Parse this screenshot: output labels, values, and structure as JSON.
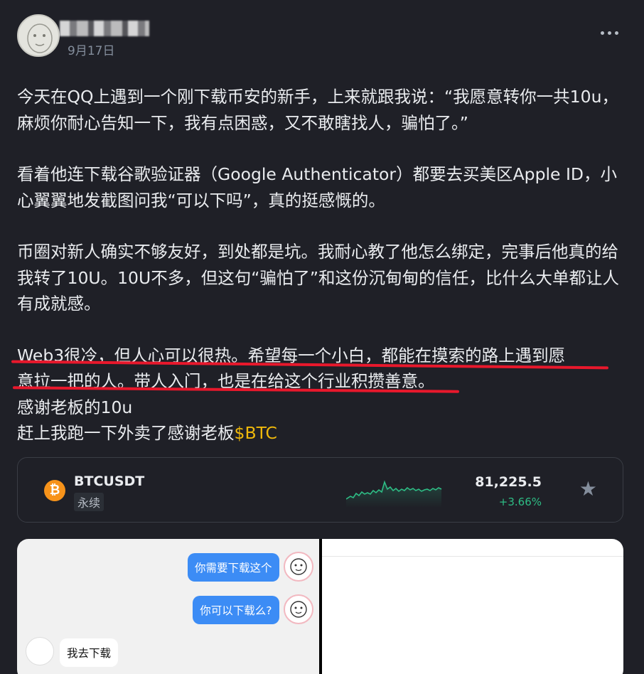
{
  "post": {
    "date": "9月17日",
    "paragraphs": [
      "今天在QQ上遇到一个刚下载币安的新手，上来就跟我说：“我愿意转你一共10u，麻烦你耐心告知一下，我有点困惑，又不敢瞎找人，骗怕了。”",
      "看着他连下载谷歌验证器（Google Authenticator）都要去买美区Apple ID，小心翼翼地发截图问我“可以下吗”，真的挺感慨的。",
      "币圈对新人确实不够友好，到处都是坑。我耐心教了他怎么绑定，完事后他真的给我转了10U。10U不多，但这句“骗怕了”和这份沉甸甸的信任，比什么大单都让人有成就感。"
    ],
    "highlight_line1": "Web3很冷，但人心可以很热。希望每一个小白，都能在摸索的路上遇到愿",
    "highlight_line2": "意拉一把的人。带人入门，也是在给这个行业积攒善意。",
    "thanks_line": "感谢老板的10u",
    "last_line_prefix": "赶上我跑一下外卖了感谢老板",
    "cashtag": "$BTC"
  },
  "ticker": {
    "icon": "bitcoin-icon",
    "symbol": "BTCUSDT",
    "contract_type": "永续",
    "price": "81,225.5",
    "change": "+3.66%",
    "accent_up": "#2ebd85",
    "coin_color": "#f7931a"
  },
  "chat": {
    "msg1": "你需要下载这个",
    "msg2": "你可以下载么?",
    "reply": "我去下载"
  },
  "colors": {
    "background": "#1f2027",
    "cashtag": "#f0b90b",
    "annotation_underline": "#e8182c"
  }
}
